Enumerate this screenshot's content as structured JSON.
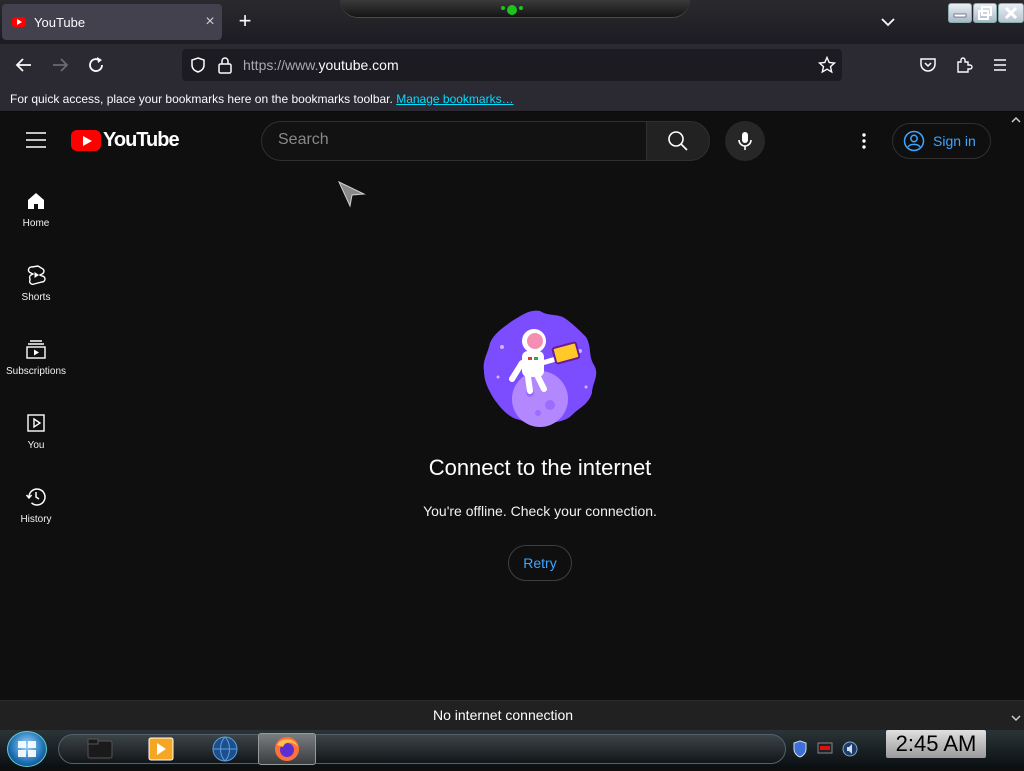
{
  "browser": {
    "tab_title": "YouTube",
    "tab_close": "×",
    "new_tab": "+",
    "url_scheme": "https://www.",
    "url_domain": "youtube.com",
    "bookmarks_message": "For quick access, place your bookmarks here on the bookmarks toolbar.",
    "manage_bookmarks": "Manage bookmarks…"
  },
  "youtube": {
    "logo_text": "YouTube",
    "search_placeholder": "Search",
    "sign_in": "Sign in",
    "guide": [
      {
        "label": "Home",
        "icon": "home-icon"
      },
      {
        "label": "Shorts",
        "icon": "shorts-icon"
      },
      {
        "label": "Subscriptions",
        "icon": "subscriptions-icon"
      },
      {
        "label": "You",
        "icon": "you-icon"
      },
      {
        "label": "History",
        "icon": "history-icon"
      }
    ],
    "offline_title": "Connect to the internet",
    "offline_message": "You're offline. Check your connection.",
    "retry": "Retry",
    "status_message": "No internet connection"
  },
  "taskbar": {
    "clock": "2:45 AM"
  },
  "colors": {
    "accent_blue": "#3ea6ff",
    "youtube_red": "#ff0000",
    "link_cyan": "#00ddff",
    "art_purple": "#7c4dff"
  }
}
